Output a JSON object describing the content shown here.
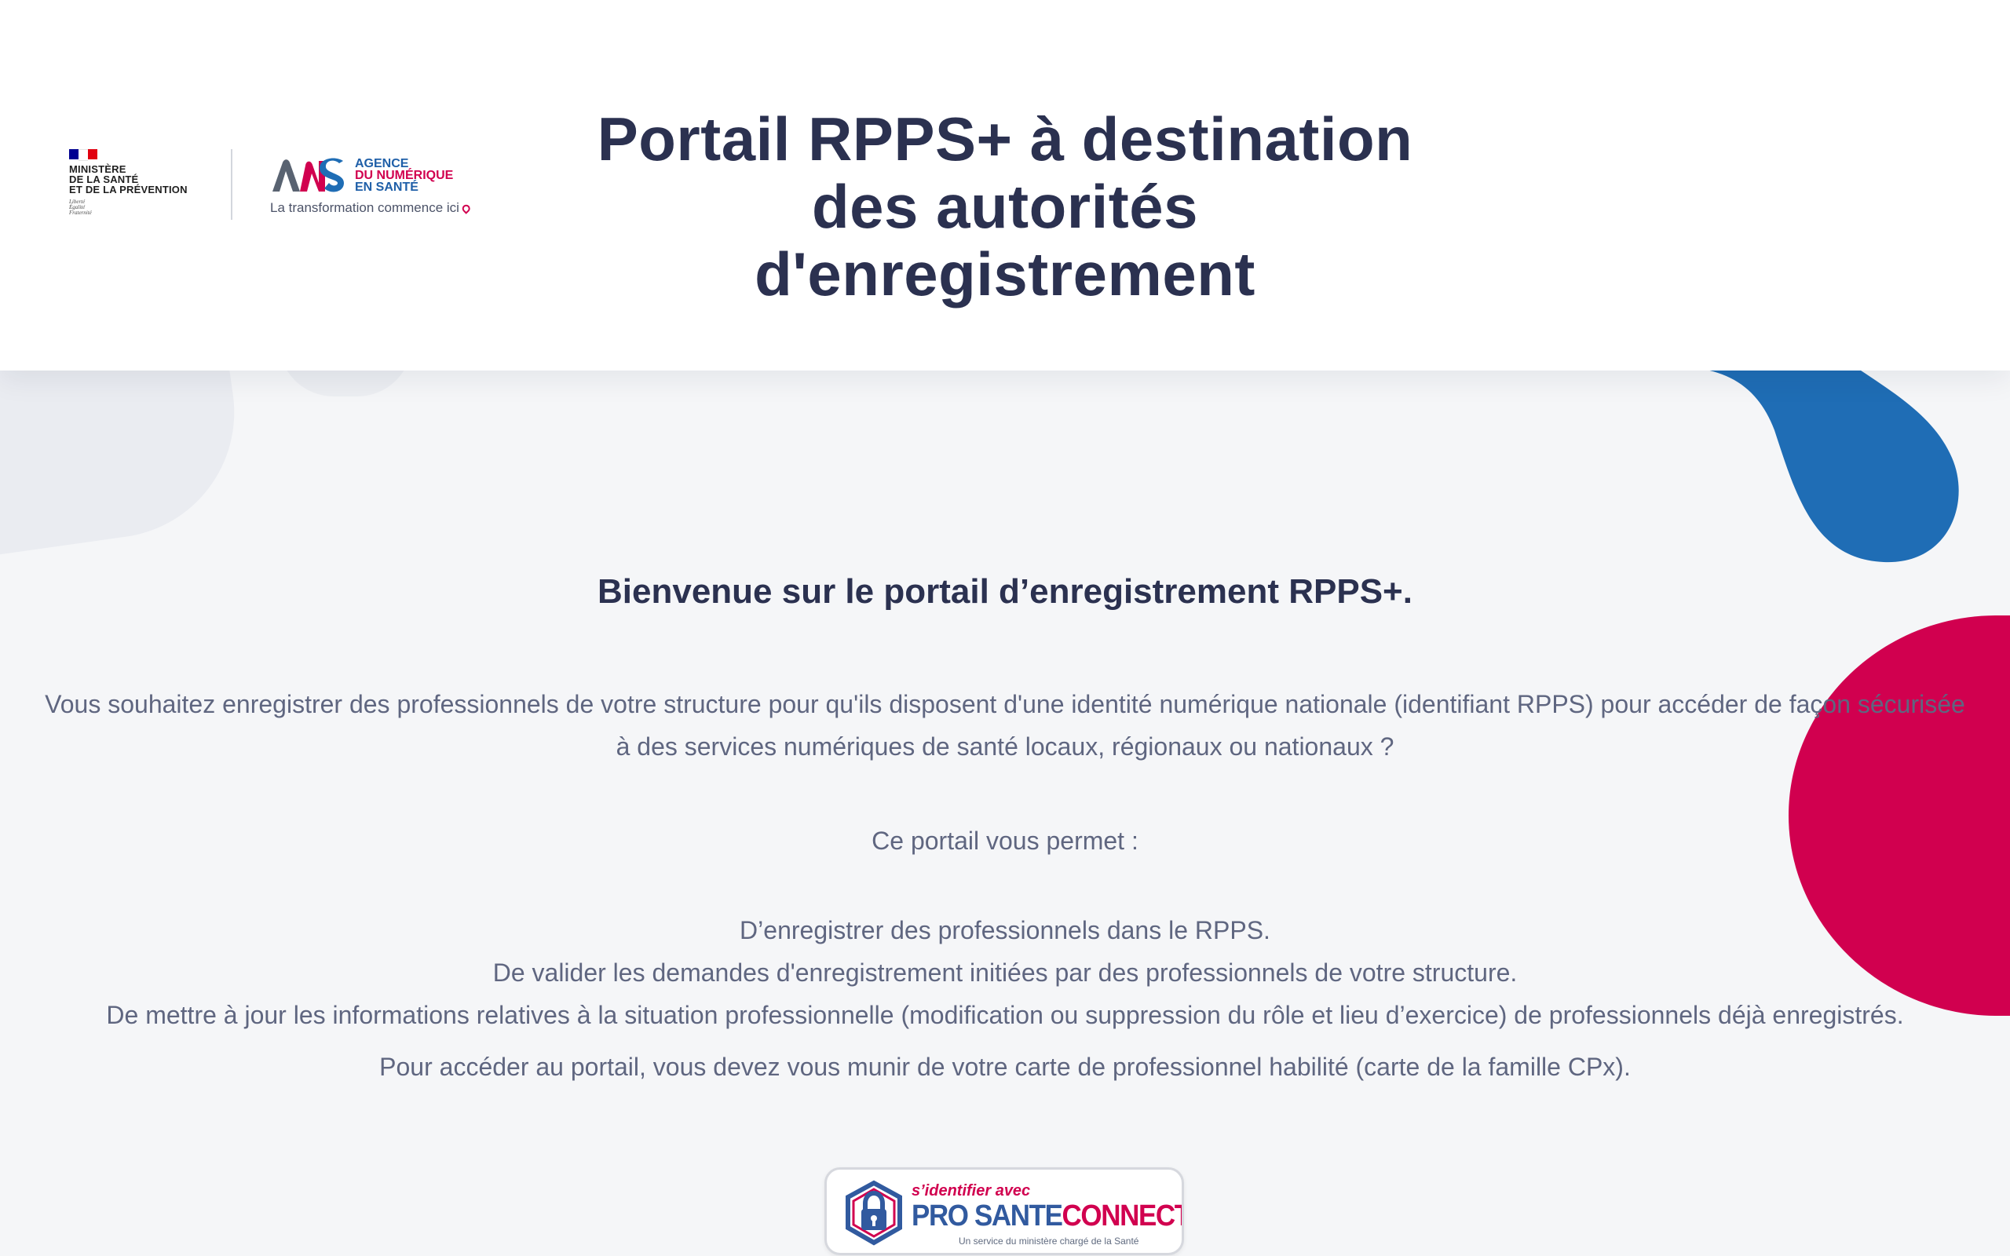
{
  "header": {
    "ministry_logo": {
      "lines": [
        "MINISTÈRE",
        "DE LA SANTÉ",
        "ET DE LA PRÉVENTION"
      ],
      "motto": [
        "Liberté",
        "Égalité",
        "Fraternité"
      ]
    },
    "agency_logo": {
      "lines": [
        "AGENCE",
        "DU NUMÉRIQUE",
        "EN SANTÉ"
      ],
      "tagline": "La transformation commence ici"
    },
    "title_lines": [
      "Portail RPPS+ à destination",
      "des autorités",
      "d'enregistrement"
    ]
  },
  "main": {
    "welcome_heading": "Bienvenue sur le portail d’enregistrement RPPS+.",
    "intro_lines": [
      "Vous souhaitez enregistrer des professionnels de votre structure pour qu'ils disposent d'une identité numérique nationale (identifiant RPPS) pour accéder de façon sécurisée",
      "à des services numériques de santé locaux, régionaux ou nationaux ?"
    ],
    "portal_lead": "Ce portail vous permet :",
    "permissions": [
      "D’enregistrer des professionnels dans le RPPS.",
      "De valider les demandes d'enregistrement initiées par des professionnels de votre structure.",
      "De mettre à jour les informations relatives à la situation professionnelle (modification ou suppression du rôle et lieu d’exercice) de professionnels déjà enregistrés."
    ],
    "access_note": "Pour accéder au portail, vous devez vous munir de votre carte de professionnel habilité (carte de la famille CPx).",
    "pro_sante_connect": {
      "top_label": "s’identifier avec",
      "brand_pro": "PRO",
      "brand_sante": "SANTE",
      "brand_connect": "CONNECT",
      "subtitle": "Un service du ministère chargé de la Santé",
      "icon": "lock-icon"
    }
  },
  "colors": {
    "navy": "#2b3150",
    "text_gray": "#5f6680",
    "blue": "#1f6db5",
    "red": "#d1004f",
    "background": "#f5f6f8"
  }
}
